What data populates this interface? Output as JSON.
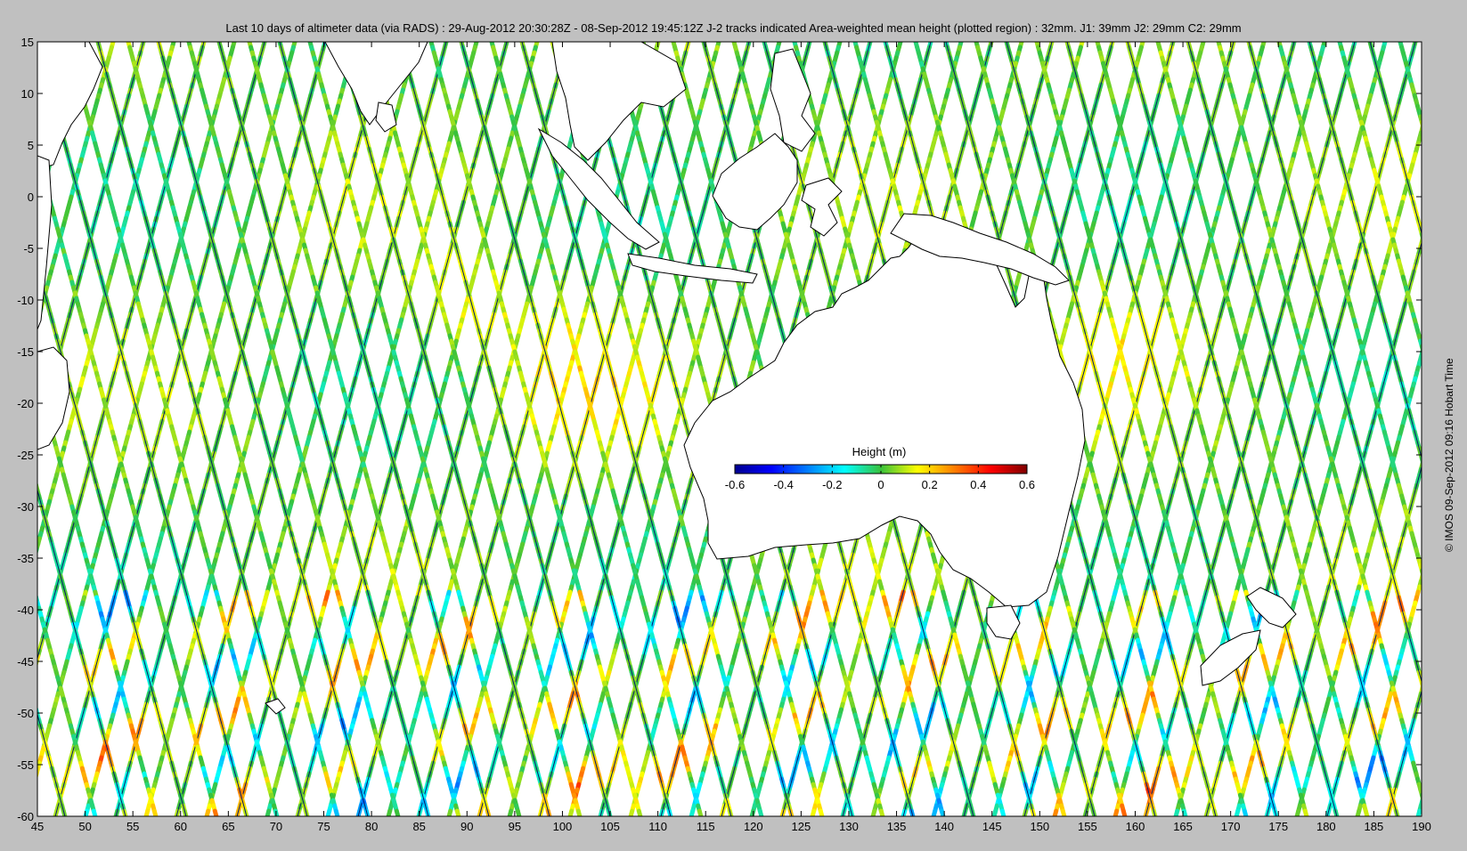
{
  "title": "Last 10 days of altimeter data (via RADS) : 29-Aug-2012 20:30:28Z - 08-Sep-2012 19:45:12Z  J-2 tracks indicated  Area-weighted mean height (plotted region) : 32mm.  J1: 39mm  J2: 29mm  C2: 29mm",
  "credit": "© IMOS 09-Sep-2012 09:16 Hobart Time",
  "colorbar": {
    "label": "Height (m)",
    "ticks": [
      "-0.6",
      "-0.4",
      "-0.2",
      "0",
      "0.2",
      "0.4",
      "0.6"
    ],
    "range": [
      -0.6,
      0.6
    ],
    "colormap": "jet"
  },
  "axes": {
    "x_ticks": [
      "45",
      "50",
      "55",
      "60",
      "65",
      "70",
      "75",
      "80",
      "85",
      "90",
      "95",
      "100",
      "105",
      "110",
      "115",
      "120",
      "125",
      "130",
      "135",
      "140",
      "145",
      "150",
      "155",
      "160",
      "165",
      "170",
      "175",
      "180",
      "185",
      "190"
    ],
    "y_ticks": [
      "15",
      "10",
      "5",
      "0",
      "-5",
      "-10",
      "-15",
      "-20",
      "-25",
      "-30",
      "-35",
      "-40",
      "-45",
      "-50",
      "-55",
      "-60"
    ],
    "lon_range": [
      45,
      190
    ],
    "lat_range": [
      -60,
      15
    ]
  },
  "colors": {
    "background": "#c0c0c0",
    "land": "#ffffff",
    "track_line": "#001a66"
  }
}
